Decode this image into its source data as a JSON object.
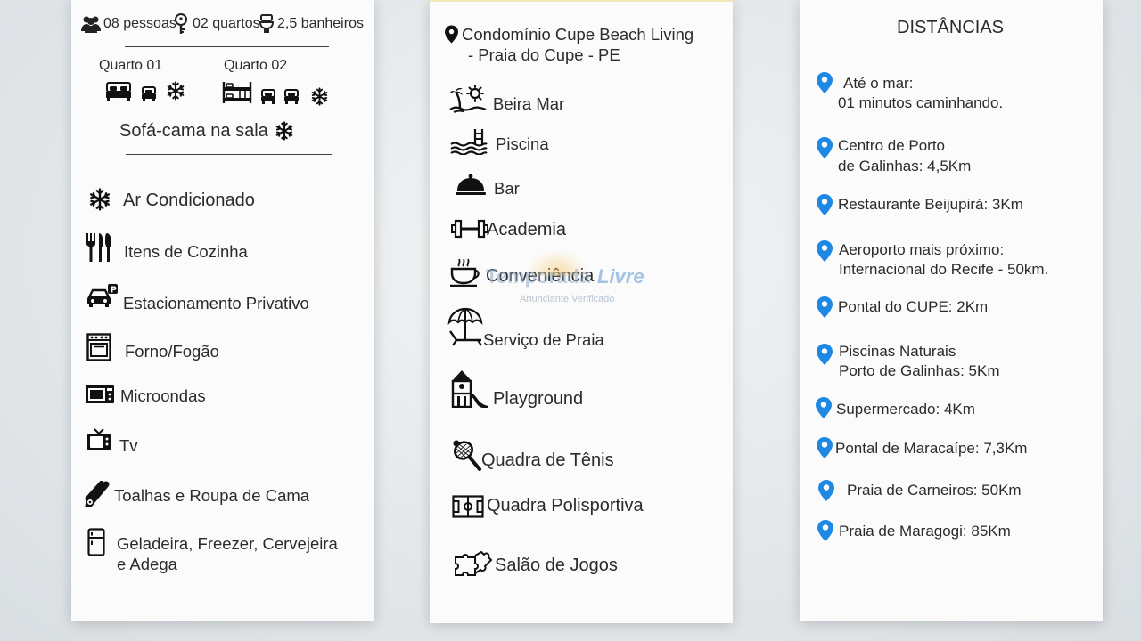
{
  "left": {
    "summary": {
      "people": "08 pessoas",
      "rooms": "02 quartos",
      "baths": "2,5 banheiros"
    },
    "room1": "Quarto 01",
    "room2": "Quarto 02",
    "sofa": "Sofá-cama na sala",
    "amenities": [
      {
        "label": "Ar Condicionado",
        "icon": "snowflake-icon"
      },
      {
        "label": "Itens de Cozinha",
        "icon": "cutlery-icon"
      },
      {
        "label": "Estacionamento Privativo",
        "icon": "parking-car-icon"
      },
      {
        "label": "Forno/Fogão",
        "icon": "stove-icon"
      },
      {
        "label": "Microondas",
        "icon": "microwave-icon"
      },
      {
        "label": "Tv",
        "icon": "tv-icon"
      },
      {
        "label": "Toalhas e Roupa de Cama",
        "icon": "towels-icon"
      },
      {
        "label": "Geladeira, Freezer, Cervejeira",
        "label2": "e Adega",
        "icon": "fridge-icon"
      }
    ]
  },
  "middle": {
    "location_line1": "Condomínio Cupe Beach Living",
    "location_line2": "- Praia do Cupe - PE",
    "features": [
      {
        "label": "Beira Mar",
        "icon": "beach-sun-icon"
      },
      {
        "label": "Piscina",
        "icon": "pool-icon"
      },
      {
        "label": "Bar",
        "icon": "cloche-icon"
      },
      {
        "label": "Academia",
        "icon": "dumbbell-icon"
      },
      {
        "label": "Conveniência",
        "icon": "coffee-cup-icon"
      },
      {
        "label": "Serviço de Praia",
        "icon": "umbrella-chair-icon"
      },
      {
        "label": "Playground",
        "icon": "playground-icon"
      },
      {
        "label": "Quadra de Tênis",
        "icon": "tennis-racket-icon"
      },
      {
        "label": "Quadra Polisportiva",
        "icon": "sports-court-icon"
      },
      {
        "label": "Salão de Jogos",
        "icon": "puzzle-icon"
      }
    ],
    "watermark": {
      "brand1": "Temporada",
      "brand2": "Livre",
      "sub": "Anunciante Verificado"
    }
  },
  "right": {
    "title": "DISTÂNCIAS",
    "items": [
      {
        "line1": "Até o mar:",
        "line2": "01 minutos caminhando."
      },
      {
        "line1": "Centro de Porto",
        "line2": "de Galinhas: 4,5Km"
      },
      {
        "line1": "Restaurante Beijupirá: 3Km",
        "line2": ""
      },
      {
        "line1": "Aeroporto mais próximo:",
        "line2": "Internacional do Recife - 50km."
      },
      {
        "line1": "Pontal do CUPE: 2Km",
        "line2": ""
      },
      {
        "line1": "Piscinas Naturais",
        "line2": "Porto de Galinhas: 5Km"
      },
      {
        "line1": "Supermercado: 4Km",
        "line2": ""
      },
      {
        "line1": "Pontal de Maracaípe: 7,3Km",
        "line2": ""
      },
      {
        "line1": "Praia de Carneiros: 50Km",
        "line2": ""
      },
      {
        "line1": "Praia de Maragogi: 85Km",
        "line2": ""
      }
    ],
    "pin_color": "#1e88e5"
  }
}
